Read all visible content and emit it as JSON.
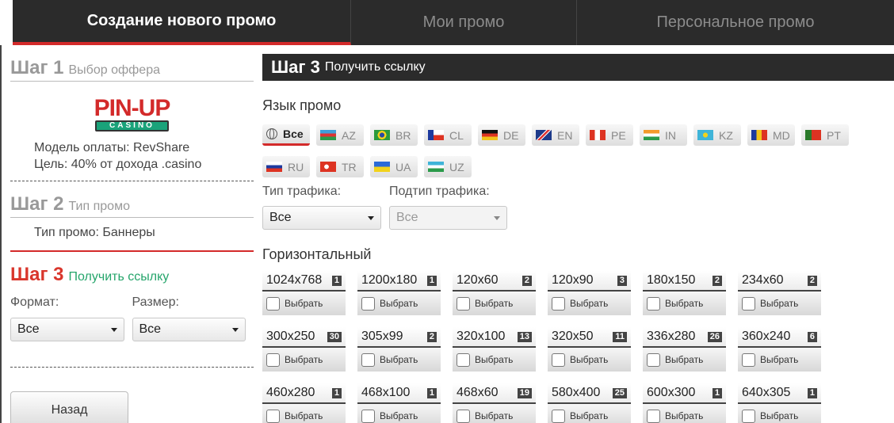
{
  "tabs": [
    {
      "label": "Создание нового промо"
    },
    {
      "label": "Мои промо"
    },
    {
      "label": "Персональное промо"
    }
  ],
  "left": {
    "step1": {
      "num": "Шаг 1",
      "sub": "Выбор оффера"
    },
    "logo": {
      "main": "PIN-UP",
      "sub": "CASINO"
    },
    "payment_model": "Модель оплаты: RevShare",
    "goal": "Цель: 40% от дохода .casino",
    "step2": {
      "num": "Шаг 2",
      "sub": "Тип промо"
    },
    "promo_type": "Тип промо: Баннеры",
    "step3": {
      "num": "Шаг 3",
      "sub": "Получить ссылку"
    },
    "format_label": "Формат:",
    "size_label": "Размер:",
    "format_value": "Все",
    "size_value": "Все",
    "back_label": "Назад"
  },
  "right": {
    "header": {
      "num": "Шаг 3",
      "sub": "Получить ссылку"
    },
    "lang_label": "Язык промо",
    "langs": [
      {
        "code": "Все"
      },
      {
        "code": "AZ"
      },
      {
        "code": "BR"
      },
      {
        "code": "CL"
      },
      {
        "code": "DE"
      },
      {
        "code": "EN"
      },
      {
        "code": "PE"
      },
      {
        "code": "IN"
      },
      {
        "code": "KZ"
      },
      {
        "code": "MD"
      },
      {
        "code": "PT"
      },
      {
        "code": "RU"
      },
      {
        "code": "TR"
      },
      {
        "code": "UA"
      },
      {
        "code": "UZ"
      }
    ],
    "traffic_label": "Тип трафика:",
    "subtraffic_label": "Подтип трафика:",
    "traffic_value": "Все",
    "subtraffic_value": "Все",
    "horizontal_label": "Горизонтальный",
    "choose_label": "Выбрать",
    "sizes": [
      {
        "size": "1024x768",
        "count": "1"
      },
      {
        "size": "1200x180",
        "count": "1"
      },
      {
        "size": "120x60",
        "count": "2"
      },
      {
        "size": "120x90",
        "count": "3"
      },
      {
        "size": "180x150",
        "count": "2"
      },
      {
        "size": "234x60",
        "count": "2"
      },
      {
        "size": "300x250",
        "count": "30"
      },
      {
        "size": "305x99",
        "count": "2"
      },
      {
        "size": "320x100",
        "count": "13"
      },
      {
        "size": "320x50",
        "count": "11"
      },
      {
        "size": "336x280",
        "count": "26"
      },
      {
        "size": "360x240",
        "count": "6"
      },
      {
        "size": "460x280",
        "count": "1"
      },
      {
        "size": "468x100",
        "count": "1"
      },
      {
        "size": "468x60",
        "count": "19"
      },
      {
        "size": "580x400",
        "count": "25"
      },
      {
        "size": "600x300",
        "count": "1"
      },
      {
        "size": "640x305",
        "count": "1"
      }
    ]
  },
  "colors": {
    "accent_red": "#d32a2a",
    "accent_green": "#25a56b",
    "dark": "#2b2b2b"
  }
}
